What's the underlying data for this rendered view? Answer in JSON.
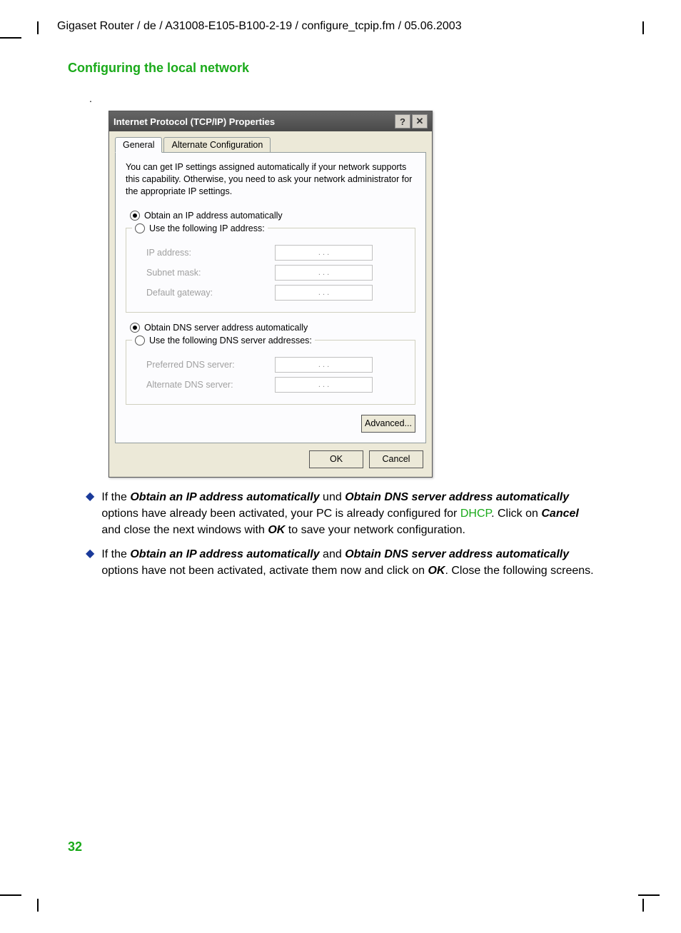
{
  "header": "Gigaset Router / de / A31008-E105-B100-2-19 / configure_tcpip.fm / 05.06.2003",
  "section_title": "Configuring the local network",
  "dot": ".",
  "dialog": {
    "title": "Internet Protocol (TCP/IP) Properties",
    "help": "?",
    "close": "✕",
    "tabs": {
      "general": "General",
      "alternate": "Alternate Configuration"
    },
    "intro": "You can get IP settings assigned automatically if your network supports this capability. Otherwise, you need to ask your network administrator for the appropriate IP settings.",
    "radio_ip_auto": "Obtain an IP address automatically",
    "radio_ip_manual": "Use the following IP address:",
    "fields": {
      "ip": "IP address:",
      "subnet": "Subnet mask:",
      "gateway": "Default gateway:"
    },
    "radio_dns_auto": "Obtain DNS server address automatically",
    "radio_dns_manual": "Use the following DNS server addresses:",
    "dns_fields": {
      "preferred": "Preferred DNS server:",
      "alternate": "Alternate DNS server:"
    },
    "ip_dots": ".    .    .",
    "advanced": "Advanced...",
    "ok": "OK",
    "cancel": "Cancel"
  },
  "bullets": {
    "b1_part1": "If the ",
    "b1_bold1": "Obtain an IP address automatically",
    "b1_part2": " und ",
    "b1_bold2": "Obtain DNS server address automatically",
    "b1_part3": "  options have already been activated, your PC is already configured for ",
    "b1_dhcp": "DHCP",
    "b1_part4": ". Click on ",
    "b1_bold3": "Cancel",
    "b1_part5": " and close the next windows with ",
    "b1_bold4": "OK",
    "b1_part6": " to save your network configuration.",
    "b2_part1": "If the ",
    "b2_bold1": "Obtain an IP address automatically",
    "b2_part2": " and ",
    "b2_bold2": "Obtain DNS server address automatically",
    "b2_part3": " options have not been activated, activate them now and click on ",
    "b2_bold3": "OK",
    "b2_part4": ". Close the following screens."
  },
  "page_number": "32"
}
